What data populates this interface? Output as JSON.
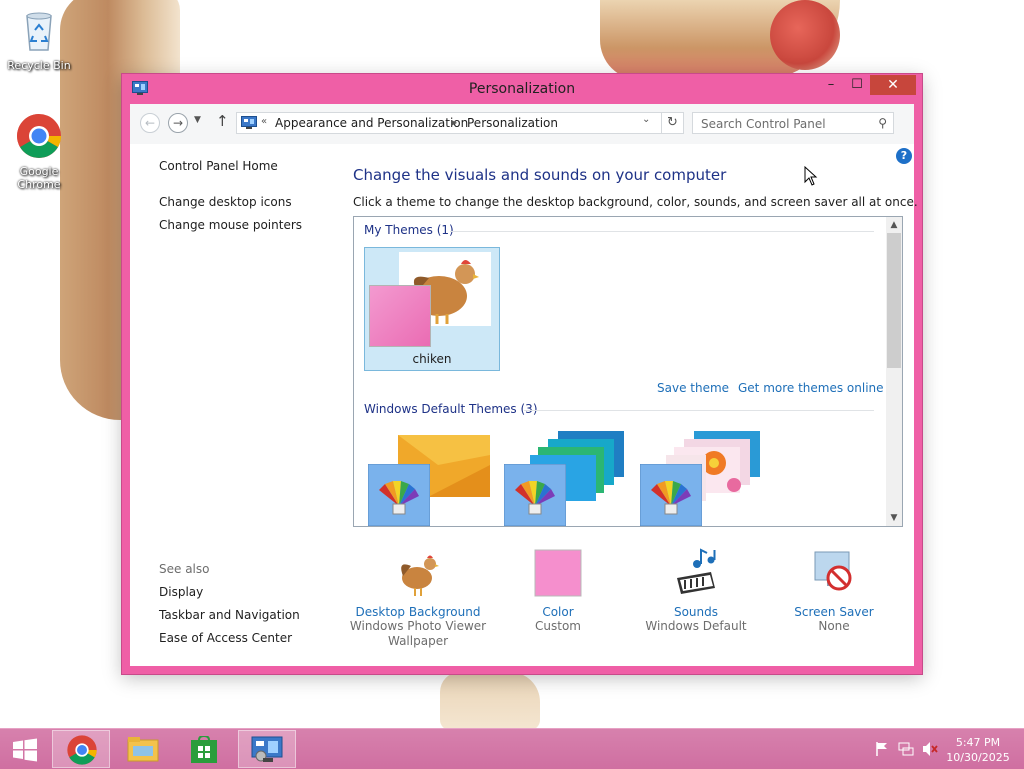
{
  "desktop": {
    "icons": [
      {
        "label": "Recycle Bin",
        "icon": "recycle-bin-icon"
      },
      {
        "label": "Google Chrome",
        "icon": "chrome-icon"
      }
    ]
  },
  "window": {
    "title": "Personalization",
    "controls": {
      "minimize": "–",
      "maximize": "☐",
      "close": "✕"
    }
  },
  "addressbar": {
    "back": "←",
    "forward": "→",
    "up": "↑",
    "overflow": "«",
    "breadcrumb": [
      "Appearance and Personalization",
      "Personalization"
    ],
    "separator": "▶",
    "dropdown": "⌄",
    "refresh": "↻",
    "search_placeholder": "Search Control Panel"
  },
  "sidebar": {
    "links": [
      "Control Panel Home",
      "Change desktop icons",
      "Change mouse pointers"
    ],
    "see_also_title": "See also",
    "see_also": [
      "Display",
      "Taskbar and Navigation",
      "Ease of Access Center"
    ]
  },
  "main": {
    "heading": "Change the visuals and sounds on your computer",
    "description": "Click a theme to change the desktop background, color, sounds, and screen saver all at once.",
    "my_themes_title": "My Themes (1)",
    "my_themes": [
      {
        "name": "chiken",
        "selected": true,
        "color": "#ef7fc2"
      }
    ],
    "save_theme": "Save theme",
    "get_more": "Get more themes online",
    "default_themes_title": "Windows Default Themes (3)"
  },
  "bottom_bar": [
    {
      "label": "Desktop Background",
      "sub": "Windows Photo Viewer Wallpaper",
      "icon": "hen-wallpaper-icon"
    },
    {
      "label": "Color",
      "sub": "Custom",
      "icon": "color-swatch-icon"
    },
    {
      "label": "Sounds",
      "sub": "Windows Default",
      "icon": "music-notes-icon"
    },
    {
      "label": "Screen Saver",
      "sub": "None",
      "icon": "screen-saver-icon"
    }
  ],
  "taskbar": {
    "time": "5:47 PM",
    "date": "10/30/2025",
    "apps": [
      "start-icon",
      "chrome-icon",
      "file-explorer-icon",
      "store-icon",
      "control-panel-icon"
    ],
    "tray": [
      "flag-icon",
      "network-icon",
      "volume-muted-icon"
    ]
  },
  "colors": {
    "window_frame": "#ef5fa6",
    "taskbar": "#d178a8",
    "link": "#1e6fb8",
    "heading": "#1e3287",
    "close_button": "#c7463c"
  }
}
